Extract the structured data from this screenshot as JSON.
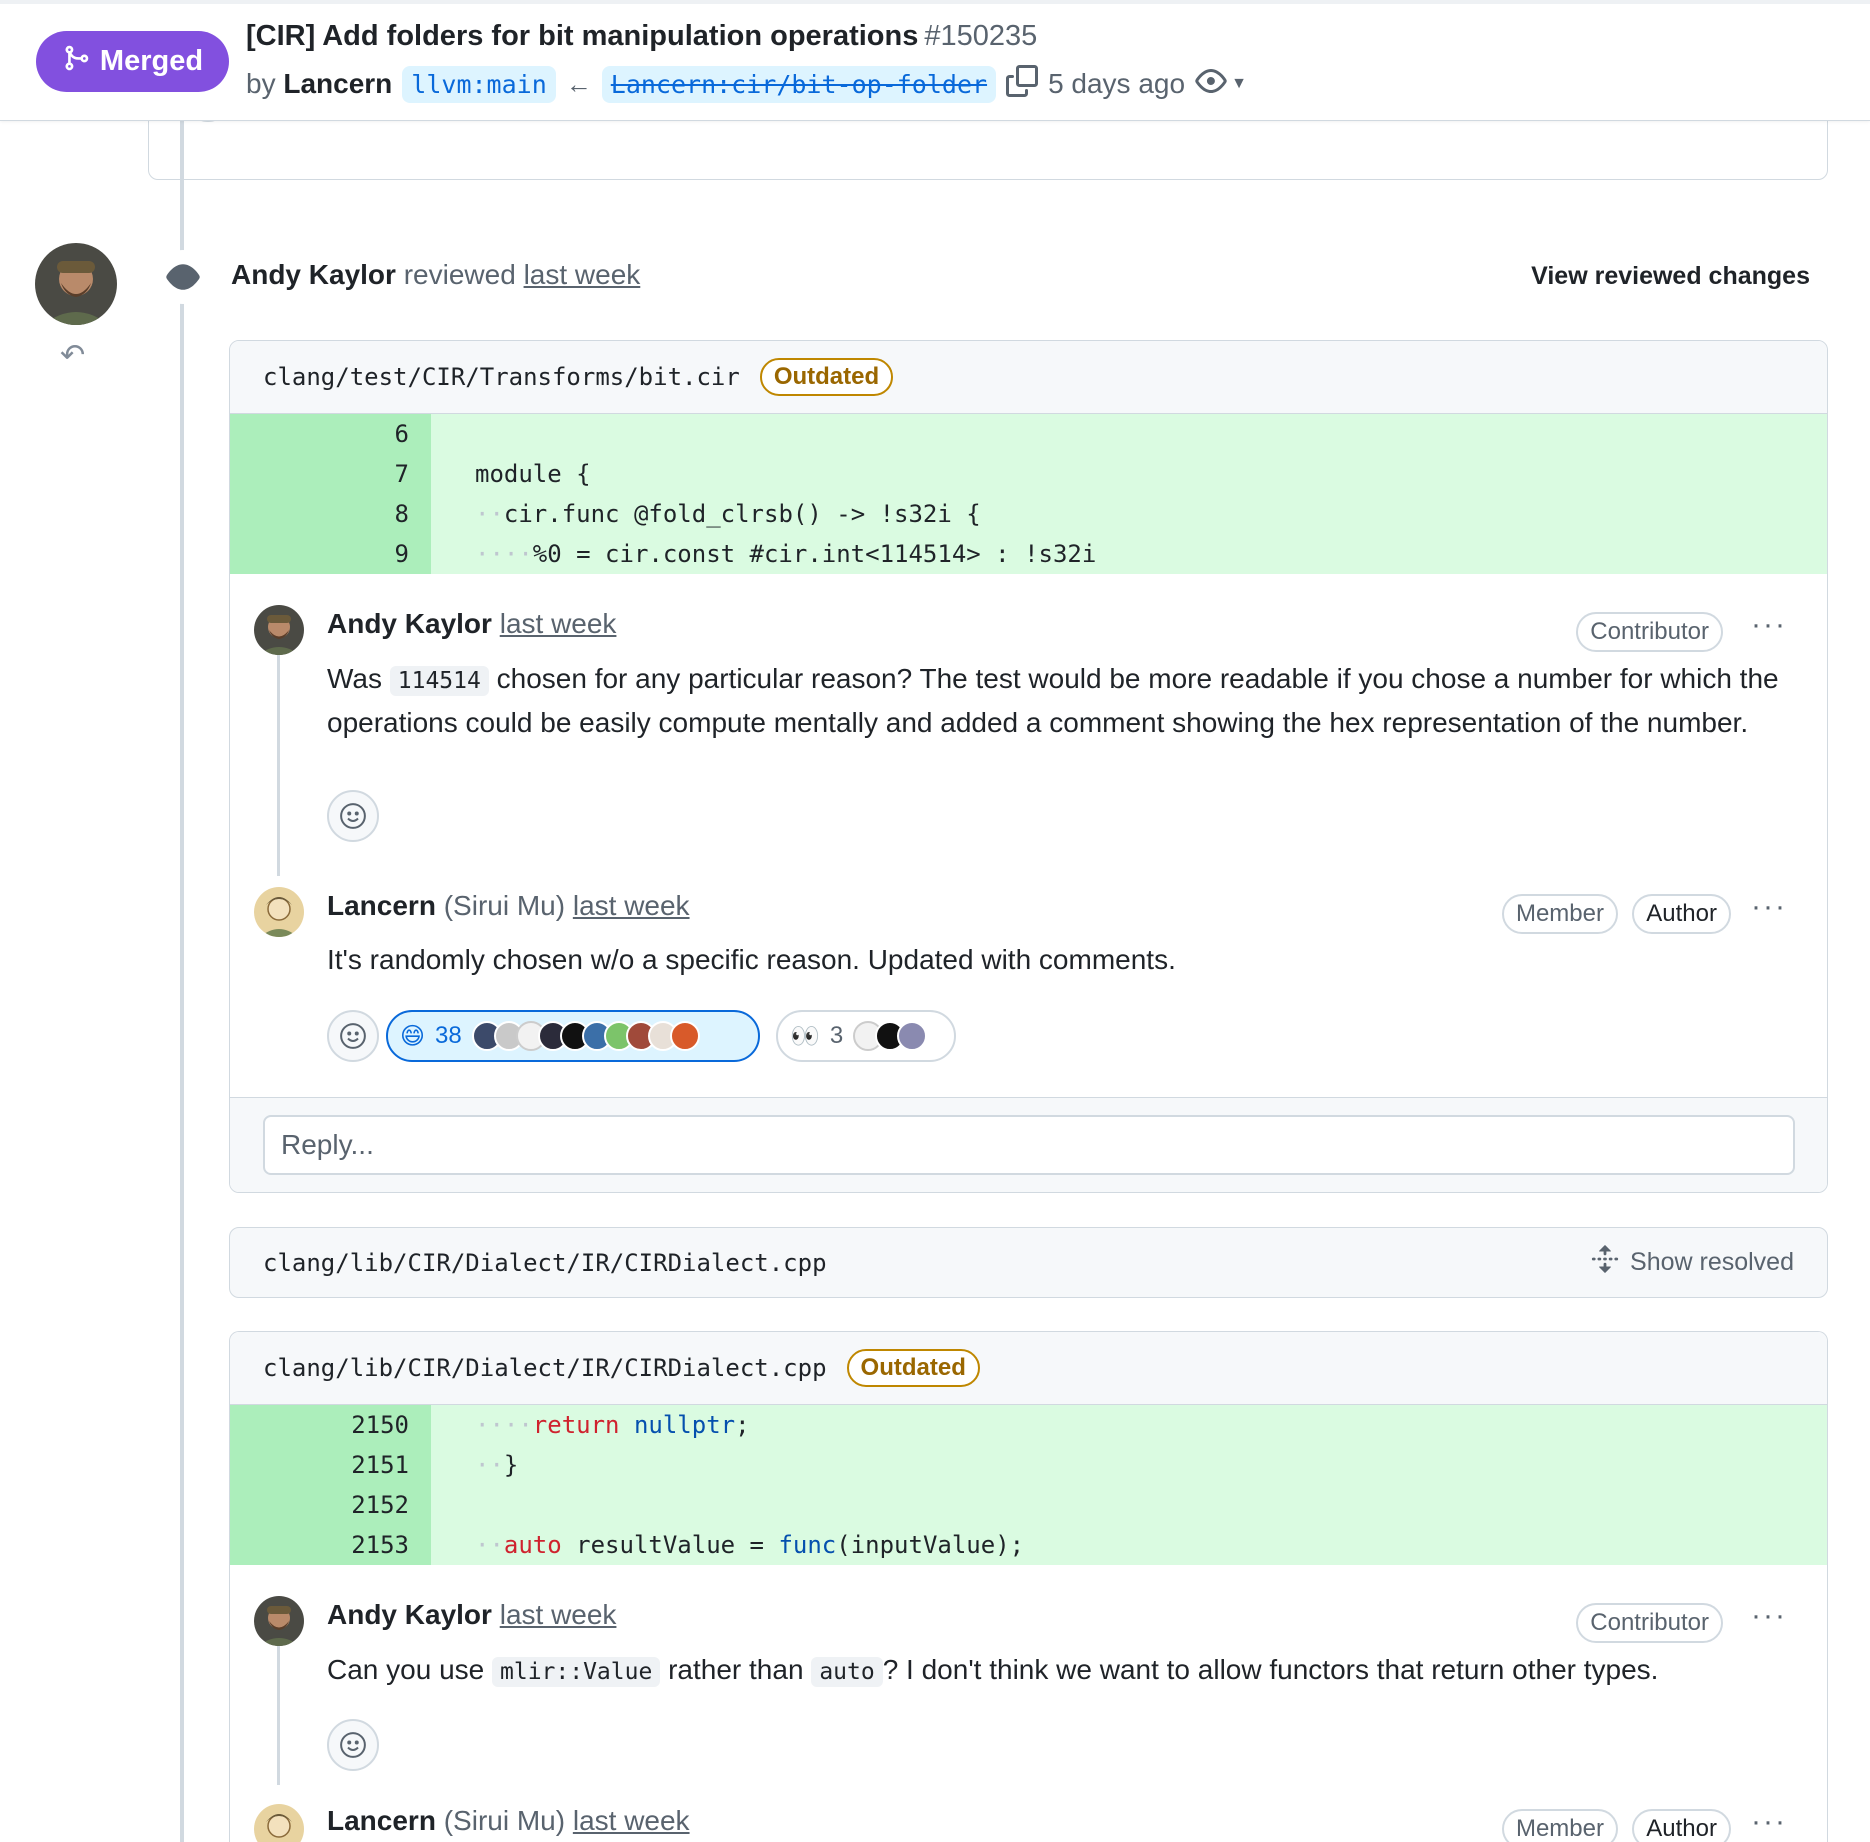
{
  "pr": {
    "status": "Merged",
    "title": "[CIR] Add folders for bit manipulation operations",
    "number": "#150235",
    "by": "by",
    "author": "Lancern",
    "base_branch": "llvm:main",
    "head_branch": "Lancern:cir/bit-op-folder",
    "time": "5 days ago"
  },
  "review": {
    "reviewer": "Andy Kaylor",
    "action": "reviewed",
    "time": "last week",
    "view_changes": "View reviewed changes"
  },
  "file1": {
    "path": "clang/test/CIR/Transforms/bit.cir",
    "badge": "Outdated",
    "lines": [
      {
        "num": "6",
        "code": ""
      },
      {
        "num": "7",
        "code": "module {"
      },
      {
        "num": "8",
        "code": "cir.func @fold_clrsb() -> !s32i {"
      },
      {
        "num": "9",
        "code": "%0 = cir.const #cir.int<114514> : !s32i"
      }
    ]
  },
  "thread1": {
    "c1": {
      "author": "Andy Kaylor",
      "time": "last week",
      "label": "Contributor",
      "more": "···",
      "text_a": "Was ",
      "code": "114514",
      "text_b": " chosen for any particular reason? The test would be more readable if you chose a number for which the operations could be easily compute mentally and added a comment showing the hex representation of the number."
    },
    "c2": {
      "author": "Lancern",
      "full_name": "(Sirui Mu)",
      "time": "last week",
      "label_member": "Member",
      "label_author": "Author",
      "more": "···",
      "text": "It's randomly chosen w/o a specific reason. Updated with comments.",
      "reaction1_emoji": "😄",
      "reaction1_count": "38",
      "reaction2_emoji": "👀",
      "reaction2_count": "3"
    },
    "reply_placeholder": "Reply..."
  },
  "resolved": {
    "path": "clang/lib/CIR/Dialect/IR/CIRDialect.cpp",
    "action": "Show resolved"
  },
  "file2": {
    "path": "clang/lib/CIR/Dialect/IR/CIRDialect.cpp",
    "badge": "Outdated",
    "lines": [
      {
        "num": "2150"
      },
      {
        "num": "2151"
      },
      {
        "num": "2152"
      },
      {
        "num": "2153"
      }
    ],
    "code": {
      "return_kw": "return",
      "nullptr": "nullptr",
      "semicolon": ";",
      "close_brace": "}",
      "auto_kw": "auto",
      "result_decl": " resultValue = ",
      "func": "func",
      "call_rest": "(inputValue);"
    }
  },
  "thread2": {
    "c1": {
      "author": "Andy Kaylor",
      "time": "last week",
      "label": "Contributor",
      "more": "···",
      "text_a": "Can you use ",
      "code1": "mlir::Value",
      "text_b": " rather than ",
      "code2": "auto",
      "text_c": "? I don't think we want to allow functors that return other types."
    },
    "c2": {
      "author": "Lancern",
      "full_name": "(Sirui Mu)",
      "time": "last week",
      "label_member": "Member",
      "label_author": "Author",
      "more": "···"
    }
  },
  "colors": {
    "merged": "#8250df",
    "added_line_bg": "#dafbe1",
    "added_num_bg": "#aceebb",
    "outdated": "#9a6700",
    "link": "#0969da"
  },
  "icons": [
    "git-merge-icon",
    "copy-icon",
    "eye-icon",
    "smiley-icon",
    "reply-icon",
    "unfold-icon",
    "kebab-icon"
  ]
}
